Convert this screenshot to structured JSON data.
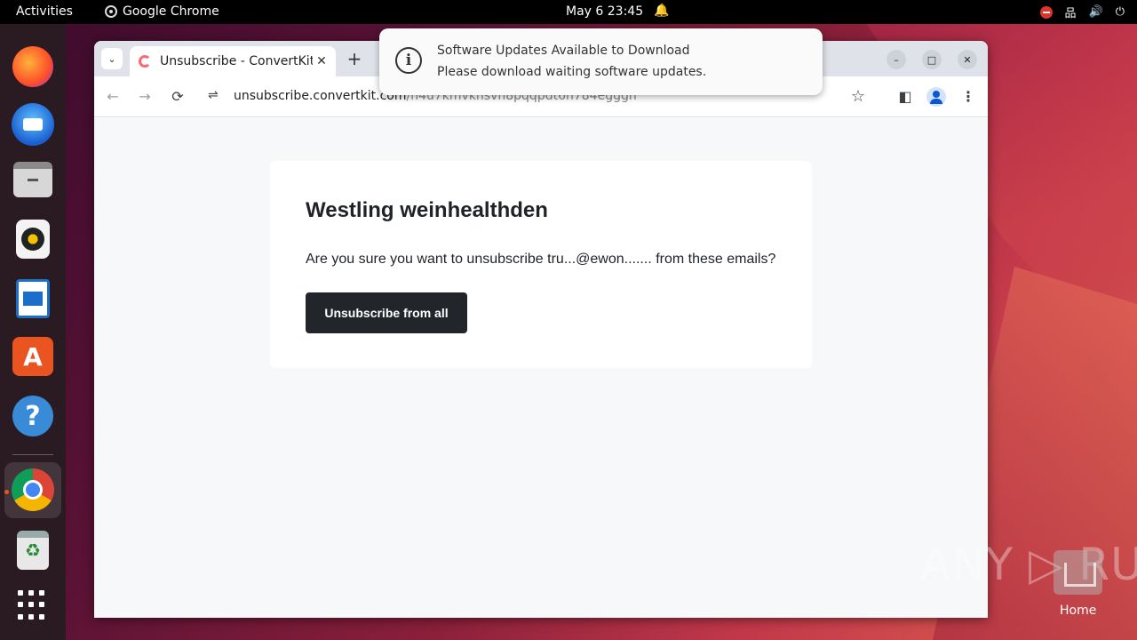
{
  "topbar": {
    "activities": "Activities",
    "app_name": "Google Chrome",
    "clock": "May 6  23:45",
    "bell": "🔔",
    "network": "品",
    "volume": "🔊",
    "power": "⏻"
  },
  "dock": {
    "items": [
      "firefox-icon",
      "thunderbird-icon",
      "files-icon",
      "rhythmbox-icon",
      "libreoffice-writer-icon",
      "app-center-icon",
      "help-icon",
      "chrome-icon",
      "trash-icon",
      "show-apps-icon"
    ],
    "store_glyph": "A",
    "help_glyph": "?",
    "trash_glyph": "♻"
  },
  "browser": {
    "tab_search": "⌄",
    "tab_title": "Unsubscribe - ConvertKit",
    "tab_close": "✕",
    "new_tab": "+",
    "min": "–",
    "max": "□",
    "close": "✕",
    "back": "←",
    "forward": "→",
    "reload": "⟳",
    "url_tune": "⇌",
    "url_host": "unsubscribe.convertkit.com",
    "url_path": "/n4u7kmvkhsvh8pqqpdt6h784egggh",
    "star": "☆",
    "side_panel": "◧",
    "menu": "⋮"
  },
  "page": {
    "title": "Westling weinhealthden",
    "text": "Are you sure you want to unsubscribe tru...@ewon....... from these emails?",
    "button": "Unsubscribe from all"
  },
  "notification": {
    "icon": "i",
    "title": "Software Updates Available to Download",
    "body": "Please download waiting software updates."
  },
  "watermark": "ANY ▷ RUN",
  "home_label": "Home"
}
